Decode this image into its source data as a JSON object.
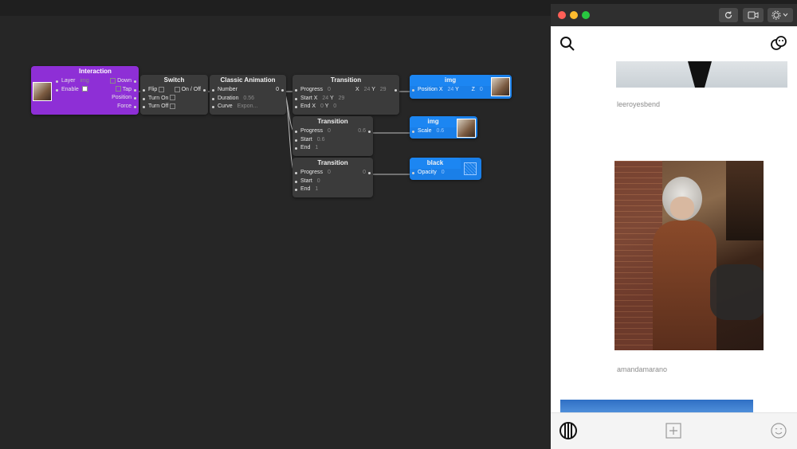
{
  "nodes": {
    "interaction": {
      "title": "Interaction",
      "layer_label": "Layer",
      "layer_value": "img",
      "enable_label": "Enable",
      "down_label": "Down",
      "tap_label": "Tap",
      "position_label": "Position",
      "force_label": "Force"
    },
    "switch": {
      "title": "Switch",
      "flip_label": "Flip",
      "onoff_label": "On / Off",
      "turnon_label": "Turn On",
      "turnoff_label": "Turn Off"
    },
    "classic_animation": {
      "title": "Classic Animation",
      "number_label": "Number",
      "number_out": "0",
      "duration_label": "Duration",
      "duration_value": "0.56",
      "curve_label": "Curve",
      "curve_value": "Expon..."
    },
    "transition1": {
      "title": "Transition",
      "progress_label": "Progress",
      "progress_value": "0",
      "x_label": "X",
      "x_value": "24",
      "y_label": "Y",
      "y_value": "29",
      "start_label": "Start",
      "start_x_label": "X",
      "start_x": "24",
      "start_y_label": "Y",
      "start_y": "29",
      "end_label": "End",
      "end_x_label": "X",
      "end_x": "0",
      "end_y_label": "Y",
      "end_y": "0"
    },
    "transition2": {
      "title": "Transition",
      "progress_label": "Progress",
      "progress_value": "0",
      "out_value": "0.6",
      "start_label": "Start",
      "start_value": "0.6",
      "end_label": "End",
      "end_value": "1"
    },
    "transition3": {
      "title": "Transition",
      "progress_label": "Progress",
      "progress_value": "0",
      "out_value": "0",
      "start_label": "Start",
      "start_value": "0",
      "end_label": "End",
      "end_value": "1"
    },
    "img_position": {
      "title": "img",
      "position_label": "Position",
      "x_label": "X",
      "x_value": "24",
      "y_label": "Y",
      "z_label": "Z",
      "z_value": "0"
    },
    "img_scale": {
      "title": "img",
      "scale_label": "Scale",
      "scale_value": "0.6"
    },
    "black_opacity": {
      "title": "black",
      "opacity_label": "Opacity",
      "opacity_value": "0"
    }
  },
  "prototype": {
    "toolbar": {
      "refresh_icon": "refresh-icon",
      "record_icon": "video-icon",
      "settings_icon": "gear-icon"
    },
    "feed": {
      "posts": [
        {
          "username": "leeroyesbend"
        },
        {
          "username": "amandamarano"
        }
      ]
    },
    "bottom_icons": [
      "stripes-icon",
      "add-icon",
      "smile-icon"
    ]
  },
  "colors": {
    "canvas_bg": "#262626",
    "node_bg": "#3b3b3b",
    "interaction_purple": "#8e2fd6",
    "layer_blue": "#1a7fe8"
  }
}
